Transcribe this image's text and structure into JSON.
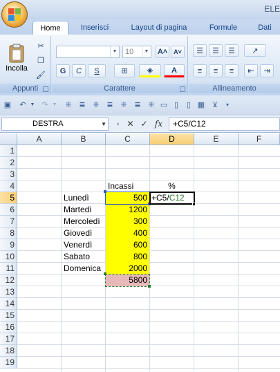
{
  "app": {
    "title_partial": "ELE"
  },
  "tabs": [
    {
      "label": "Home",
      "active": true
    },
    {
      "label": "Inserisci"
    },
    {
      "label": "Layout di pagina"
    },
    {
      "label": "Formule"
    },
    {
      "label": "Dati"
    }
  ],
  "ribbon": {
    "clipboard": {
      "paste_label": "Incolla",
      "group_label": "Appunti"
    },
    "font": {
      "font_name": "",
      "font_size": "10",
      "group_label": "Carattere",
      "bold": "G",
      "italic": "C",
      "underline": "S"
    },
    "alignment": {
      "group_label": "Allineamento"
    }
  },
  "formula_bar": {
    "name_box": "DESTRA",
    "fx_label": "fx",
    "formula": "+C5/C12"
  },
  "grid": {
    "columns": [
      "A",
      "B",
      "C",
      "D",
      "E",
      "F"
    ],
    "selected_column": "D",
    "rows": [
      "1",
      "2",
      "3",
      "4",
      "5",
      "6",
      "7",
      "8",
      "9",
      "10",
      "11",
      "12",
      "13",
      "14",
      "15",
      "16",
      "17",
      "18",
      "19"
    ],
    "selected_row": "5",
    "header_incassi": "Incassi",
    "header_percent": "%",
    "days": [
      "Lunedì",
      "Martedì",
      "Mercoledì",
      "Giovedì",
      "Venerdì",
      "Sabato",
      "Domenica"
    ],
    "values": [
      "500",
      "1200",
      "300",
      "400",
      "600",
      "800",
      "2000"
    ],
    "total": "5800",
    "edit_cell": {
      "prefix": "+C5/",
      "ref": "C12"
    }
  },
  "colors": {
    "value_fill": "#ffff00",
    "total_fill": "#e6b9b8",
    "ribbon_accent": "#15428b"
  }
}
